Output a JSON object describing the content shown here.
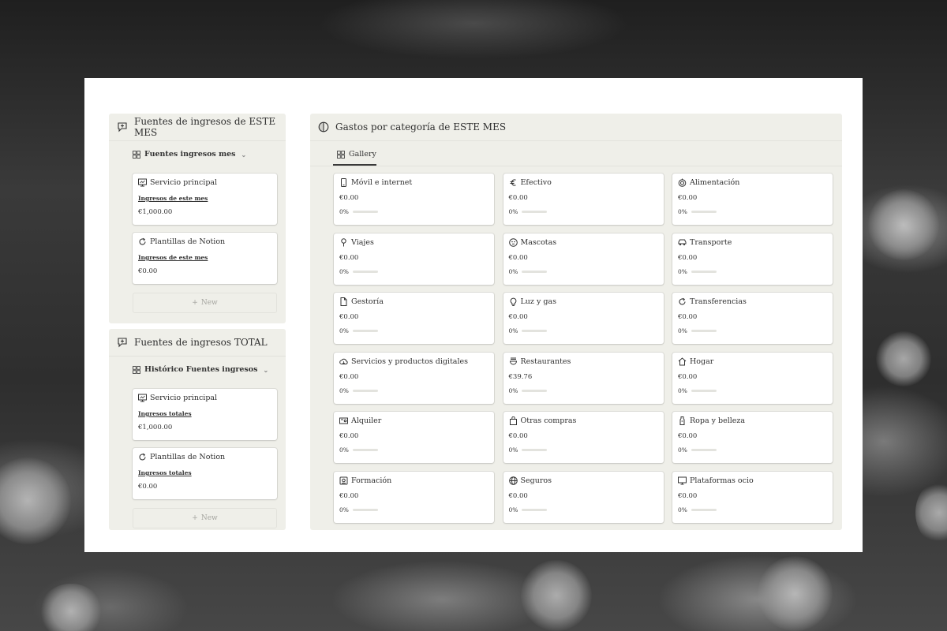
{
  "monthly_income": {
    "title": "Fuentes de ingresos de ESTE MES",
    "view_label": "Fuentes ingresos mes",
    "cards": [
      {
        "icon": "monitor-icon",
        "name": "Servicio principal",
        "link": "Ingresos de este mes",
        "amount": "€1,000.00"
      },
      {
        "icon": "refresh-icon",
        "name": "Plantillas de Notion",
        "link": "Ingresos de este mes",
        "amount": "€0.00"
      }
    ],
    "new_label": "New"
  },
  "total_income": {
    "title": "Fuentes de ingresos TOTAL",
    "view_label": "Histórico Fuentes ingresos",
    "cards": [
      {
        "icon": "monitor-icon",
        "name": "Servicio principal",
        "link": "Ingresos totales",
        "amount": "€1,000.00"
      },
      {
        "icon": "refresh-icon",
        "name": "Plantillas de Notion",
        "link": "Ingresos totales",
        "amount": "€0.00"
      }
    ],
    "new_label": "New"
  },
  "expenses": {
    "title": "Gastos por categoría de ESTE MES",
    "view_label": "Gallery",
    "cards": [
      {
        "icon": "phone-icon",
        "name": "Móvil e internet",
        "amount": "€0.00",
        "percent": "0%",
        "progress": 0
      },
      {
        "icon": "euro-icon",
        "name": "Efectivo",
        "amount": "€0.00",
        "percent": "0%",
        "progress": 0
      },
      {
        "icon": "food-icon",
        "name": "Alimentación",
        "amount": "€0.00",
        "percent": "0%",
        "progress": 0
      },
      {
        "icon": "pin-icon",
        "name": "Viajes",
        "amount": "€0.00",
        "percent": "0%",
        "progress": 0
      },
      {
        "icon": "pet-icon",
        "name": "Mascotas",
        "amount": "€0.00",
        "percent": "0%",
        "progress": 0
      },
      {
        "icon": "car-icon",
        "name": "Transporte",
        "amount": "€0.00",
        "percent": "0%",
        "progress": 0
      },
      {
        "icon": "document-icon",
        "name": "Gestoría",
        "amount": "€0.00",
        "percent": "0%",
        "progress": 0
      },
      {
        "icon": "bulb-icon",
        "name": "Luz y gas",
        "amount": "€0.00",
        "percent": "0%",
        "progress": 0
      },
      {
        "icon": "refresh-icon",
        "name": "Transferencias",
        "amount": "€0.00",
        "percent": "0%",
        "progress": 0
      },
      {
        "icon": "cloud-icon",
        "name": "Servicios y productos digitales",
        "amount": "€0.00",
        "percent": "0%",
        "progress": 0
      },
      {
        "icon": "restaurant-icon",
        "name": "Restaurantes",
        "amount": "€39.76",
        "percent": "0%",
        "progress": 0
      },
      {
        "icon": "home-icon",
        "name": "Hogar",
        "amount": "€0.00",
        "percent": "0%",
        "progress": 0
      },
      {
        "icon": "key-icon",
        "name": "Alquiler",
        "amount": "€0.00",
        "percent": "0%",
        "progress": 0
      },
      {
        "icon": "bag-icon",
        "name": "Otras compras",
        "amount": "€0.00",
        "percent": "0%",
        "progress": 0
      },
      {
        "icon": "bottle-icon",
        "name": "Ropa y belleza",
        "amount": "€0.00",
        "percent": "0%",
        "progress": 0
      },
      {
        "icon": "book-icon",
        "name": "Formación",
        "amount": "€0.00",
        "percent": "0%",
        "progress": 0
      },
      {
        "icon": "globe-icon",
        "name": "Seguros",
        "amount": "€0.00",
        "percent": "0%",
        "progress": 0
      },
      {
        "icon": "tv-icon",
        "name": "Plataformas ocio",
        "amount": "€0.00",
        "percent": "0%",
        "progress": 0
      }
    ]
  }
}
